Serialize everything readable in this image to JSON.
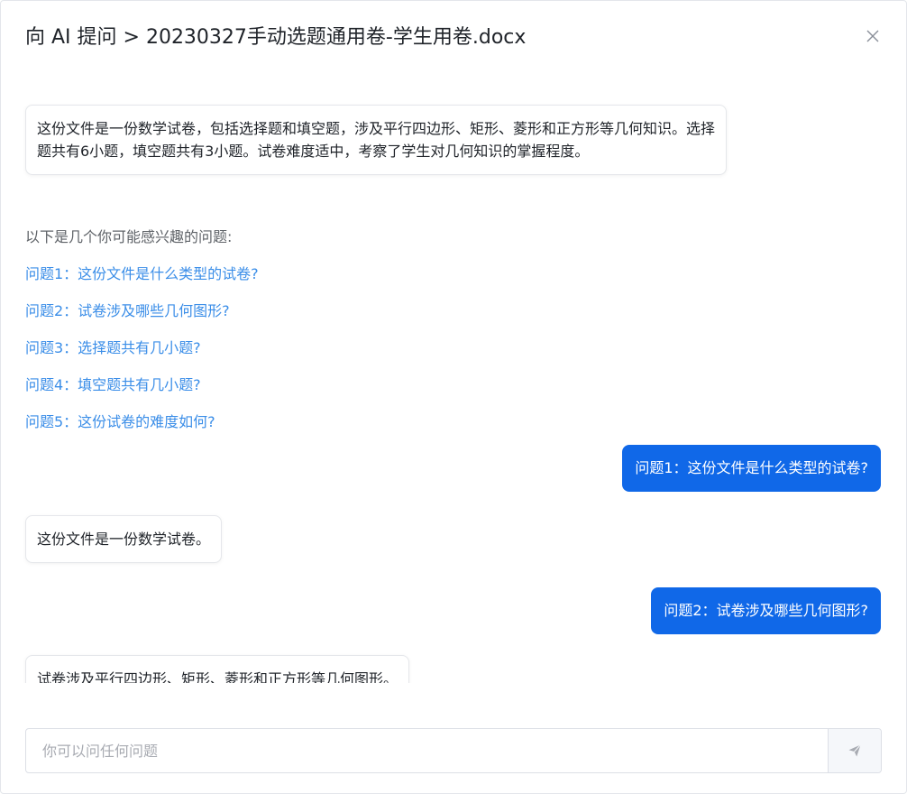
{
  "dialog": {
    "title": "向 AI 提问 > 20230327手动选题通用卷-学生用卷.docx"
  },
  "icons": {
    "close": "close-icon",
    "send": "send-icon"
  },
  "colors": {
    "accent": "#1068e8",
    "link": "#3b8ee8"
  },
  "chat": {
    "summary": "这份文件是一份数学试卷，包括选择题和填空题，涉及平行四边形、矩形、菱形和正方形等几何知识。选择题共有6小题，填空题共有3小题。试卷难度适中，考察了学生对几何知识的掌握程度。",
    "suggest_title": "以下是几个你可能感兴趣的问题:",
    "suggestions": [
      "问题1：这份文件是什么类型的试卷?",
      "问题2：试卷涉及哪些几何图形?",
      "问题3：选择题共有几小题?",
      "问题4：填空题共有几小题?",
      "问题5：这份试卷的难度如何?"
    ],
    "messages": [
      {
        "role": "user",
        "text": "问题1：这份文件是什么类型的试卷?"
      },
      {
        "role": "ai",
        "text": "这份文件是一份数学试卷。"
      },
      {
        "role": "user",
        "text": "问题2：试卷涉及哪些几何图形?"
      },
      {
        "role": "ai",
        "text": "试卷涉及平行四边形、矩形、菱形和正方形等几何图形。"
      }
    ]
  },
  "input": {
    "placeholder": "你可以问任何问题",
    "value": ""
  }
}
